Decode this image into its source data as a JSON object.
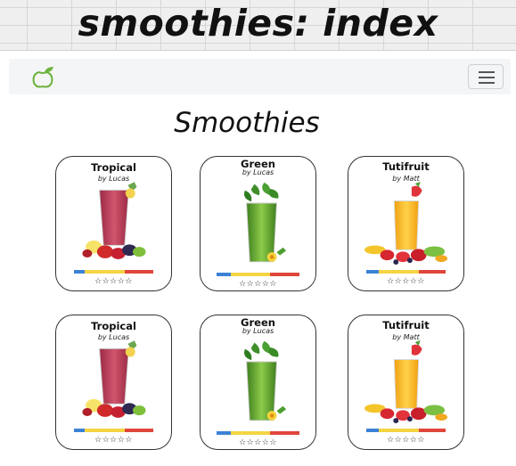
{
  "banner": {
    "title": "smoothies: index"
  },
  "navbar": {
    "brand_icon": "apple-leaf-logo",
    "menu_icon": "hamburger-icon"
  },
  "page": {
    "heading": "Smoothies"
  },
  "rating_colors": [
    "#3b82d6",
    "#f5d442",
    "#e0463b"
  ],
  "cards": [
    {
      "title": "Tropical",
      "author": "by Lucas",
      "image": "red-smoothie-with-berries",
      "stars": "☆☆☆☆☆",
      "rating_stars": 0
    },
    {
      "title": "Green",
      "author": "by Lucas",
      "image": "green-smoothie-with-herbs",
      "stars": "☆☆☆☆☆",
      "rating_stars": 0
    },
    {
      "title": "Tutifruit",
      "author": "by Matt",
      "image": "orange-smoothie-with-fruit",
      "stars": "☆☆☆☆☆",
      "rating_stars": 0
    },
    {
      "title": "Tropical",
      "author": "by Lucas",
      "image": "red-smoothie-with-berries",
      "stars": "☆☆☆☆☆",
      "rating_stars": 0
    },
    {
      "title": "Green",
      "author": "by Lucas",
      "image": "green-smoothie-with-herbs",
      "stars": "☆☆☆☆☆",
      "rating_stars": 0
    },
    {
      "title": "Tutifruit",
      "author": "by Matt",
      "image": "orange-smoothie-with-fruit",
      "stars": "☆☆☆☆☆",
      "rating_stars": 0
    }
  ]
}
